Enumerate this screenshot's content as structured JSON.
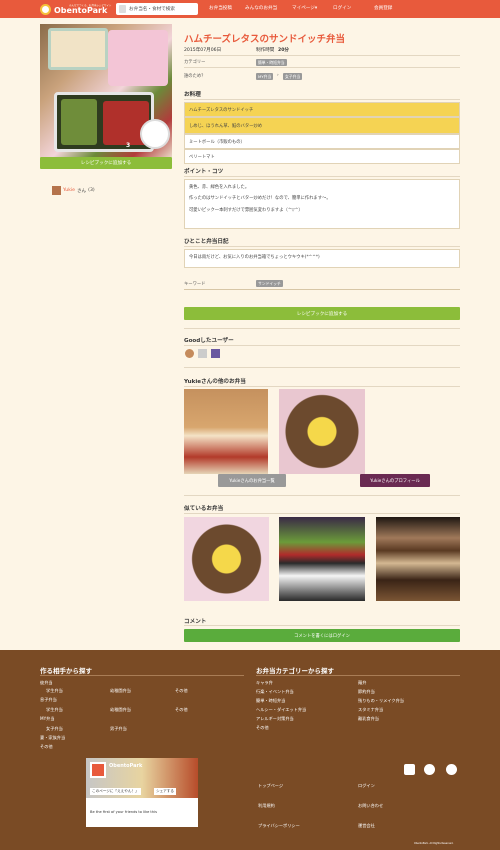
{
  "header": {
    "logo_tagline": "みんなでつくる、お弁当レシピサイト",
    "logo_text": "ObentoPark",
    "search_placeholder": "お弁当名・食材で検索",
    "nav": [
      "お弁当投稿",
      "みんなのお弁当",
      "マイページ▾",
      "ログイン",
      "会員登録"
    ]
  },
  "photo": {
    "count": "3"
  },
  "add_recipe_label": "レシピブックに追加する",
  "author": {
    "name": "Yukie",
    "suffix": "さん",
    "count": "(3)"
  },
  "recipe": {
    "title": "ハムチーズレタスのサンドイッチ弁当",
    "date": "2015年07月06日",
    "time_label": "制作時間",
    "time_value": "20分",
    "category_label": "カテゴリー",
    "category_value": "簡単・時短弁当",
    "for_label": "誰のため？",
    "for_values": [
      "MY弁当",
      "女子弁当"
    ]
  },
  "dishes_title": "お料理",
  "dishes": [
    "ハムチーズレタスのサンドイッチ",
    "しめじ、ほうれん草、鮭のバター炒め",
    "ミートボール（市販のもの）",
    "ベリートマト"
  ],
  "points_title": "ポイント・コツ",
  "points": [
    "黄色、赤、緑色を入れました。",
    "作ったのはサンドイッチとバター炒めだけ！なので、簡単に作れます〜。",
    "可愛いピック一本刺すだけで雰囲気変わりますよ（^▽^）"
  ],
  "diary_title": "ひとこと弁当日記",
  "diary_text": "今日は雨だけど、お気に入りのお弁当箱でちょっとウキウキ(*^^*)",
  "keyword_label": "キーワード",
  "keyword_value": "サンドイッチ",
  "good_users_title": "Goodしたユーザー",
  "others_title": "Yukieさんの他のお弁当",
  "others_list_btn": "Yukieさんのお弁当一覧",
  "profile_btn": "Yukieさんのプロフィール",
  "similar_title": "似ているお弁当",
  "comment_title": "コメント",
  "comment_btn": "コメントを書くにはログイン",
  "footer": {
    "left_title": "作る相手から探す",
    "left_items": [
      "彼弁当",
      "学生弁当",
      "幼稚園弁当",
      "その他",
      "息子弁当",
      "学生弁当",
      "幼稚園弁当",
      "その他",
      "MY弁当",
      "女子弁当",
      "男子弁当",
      "妻・家族弁当",
      "その他"
    ],
    "right_title": "お弁当カテゴリーから探す",
    "right_col1": [
      "キャラ弁",
      "行楽・イベント弁当",
      "簡単・時短弁当",
      "ヘルシー・ダイエット弁当",
      "アレルギー対策弁当",
      "その他"
    ],
    "right_col2": [
      "麺弁",
      "節約弁当",
      "残りもの・リメイク弁当",
      "スタミナ弁当",
      "離乳食弁当"
    ],
    "fb": {
      "name": "ObentoPark",
      "like": "このページに「ええやん！」",
      "share": "シェアする",
      "text": "Be the first of your friends to like this"
    },
    "links": [
      "トップページ",
      "ログイン",
      "利用規約",
      "お問い合わせ",
      "プライバシーポリシー",
      "運営会社"
    ],
    "copyright": "ObentoPark. All Rights Reserved."
  }
}
